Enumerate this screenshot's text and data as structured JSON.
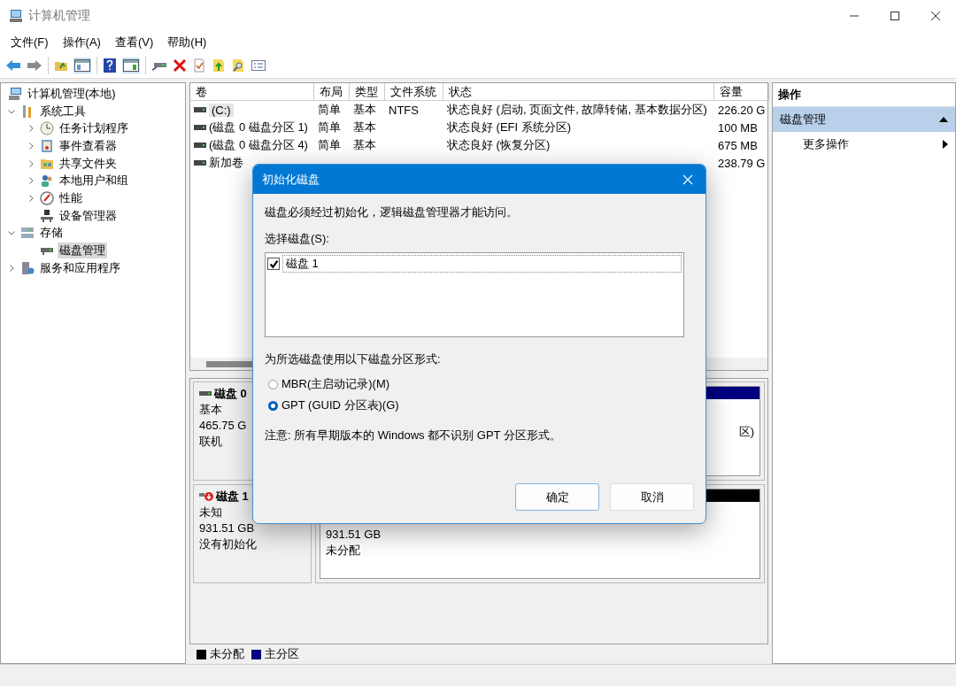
{
  "window": {
    "title": "计算机管理"
  },
  "menu": [
    "文件(F)",
    "操作(A)",
    "查看(V)",
    "帮助(H)"
  ],
  "tree": [
    {
      "label": "计算机管理(本地)",
      "kind": "computer",
      "selected": false,
      "children": [
        {
          "label": "系统工具",
          "kind": "tools",
          "expanded": true,
          "selected": false,
          "children": [
            {
              "label": "任务计划程序",
              "kind": "clock",
              "expanded": false,
              "selected": false
            },
            {
              "label": "事件查看器",
              "kind": "event",
              "expanded": false,
              "selected": false
            },
            {
              "label": "共享文件夹",
              "kind": "share",
              "expanded": false,
              "selected": false
            },
            {
              "label": "本地用户和组",
              "kind": "users",
              "expanded": false,
              "selected": false
            },
            {
              "label": "性能",
              "kind": "perf",
              "expanded": false,
              "selected": false
            },
            {
              "label": "设备管理器",
              "kind": "device",
              "selected": false
            }
          ]
        },
        {
          "label": "存储",
          "kind": "storage",
          "expanded": true,
          "selected": false,
          "children": [
            {
              "label": "磁盘管理",
              "kind": "disk",
              "selected": true
            }
          ]
        },
        {
          "label": "服务和应用程序",
          "kind": "services",
          "expanded": false,
          "selected": false
        }
      ]
    }
  ],
  "volumes": {
    "columns": [
      "卷",
      "布局",
      "类型",
      "文件系统",
      "状态",
      "容量"
    ],
    "rows": [
      {
        "volume": "(C:)",
        "layout": "简单",
        "type": "基本",
        "fs": "NTFS",
        "status": "状态良好 (启动, 页面文件, 故障转储, 基本数据分区)",
        "capacity": "226.20 G",
        "selected": true
      },
      {
        "volume": "(磁盘 0 磁盘分区 1)",
        "layout": "简单",
        "type": "基本",
        "status": "状态良好 (EFI 系统分区)",
        "capacity": "100 MB",
        "selected": false
      },
      {
        "volume": "(磁盘 0 磁盘分区 4)",
        "layout": "简单",
        "type": "基本",
        "status": "状态良好 (恢复分区)",
        "capacity": "675 MB",
        "selected": false
      },
      {
        "volume": "新加卷",
        "capacity": "238.79 G",
        "selected": false
      }
    ]
  },
  "disks": [
    {
      "name": "磁盘 0",
      "kind": "online",
      "lines": [
        "基本",
        "465.75 G",
        "联机"
      ],
      "partitions": [
        {
          "color": "#000080",
          "lines": [
            "区)"
          ]
        }
      ]
    },
    {
      "name": "磁盘 1",
      "kind": "error",
      "lines": [
        "未知",
        "931.51 GB",
        "没有初始化"
      ],
      "partitions": [
        {
          "color": "#000000",
          "lines": [
            "931.51 GB",
            "未分配"
          ]
        }
      ]
    }
  ],
  "legend": [
    {
      "label": "未分配",
      "color": "#000000"
    },
    {
      "label": "主分区",
      "color": "#000080"
    }
  ],
  "actions": {
    "title": "操作",
    "sections": [
      {
        "label": "磁盘管理",
        "expanded": true,
        "items": [
          "更多操作"
        ]
      }
    ]
  },
  "dialog": {
    "title": "初始化磁盘",
    "message": "磁盘必须经过初始化，逻辑磁盘管理器才能访问。",
    "select_label": "选择磁盘(S):",
    "disks": [
      {
        "label": "磁盘 1",
        "checked": true
      }
    ],
    "style_label": "为所选磁盘使用以下磁盘分区形式:",
    "options": [
      {
        "label": "MBR(主启动记录)(M)",
        "selected": false
      },
      {
        "label": "GPT (GUID 分区表)(G)",
        "selected": true
      }
    ],
    "note": "注意: 所有早期版本的 Windows 都不识别 GPT 分区形式。",
    "buttons": [
      {
        "label": "确定",
        "default": true
      },
      {
        "label": "取消",
        "default": false
      }
    ]
  }
}
